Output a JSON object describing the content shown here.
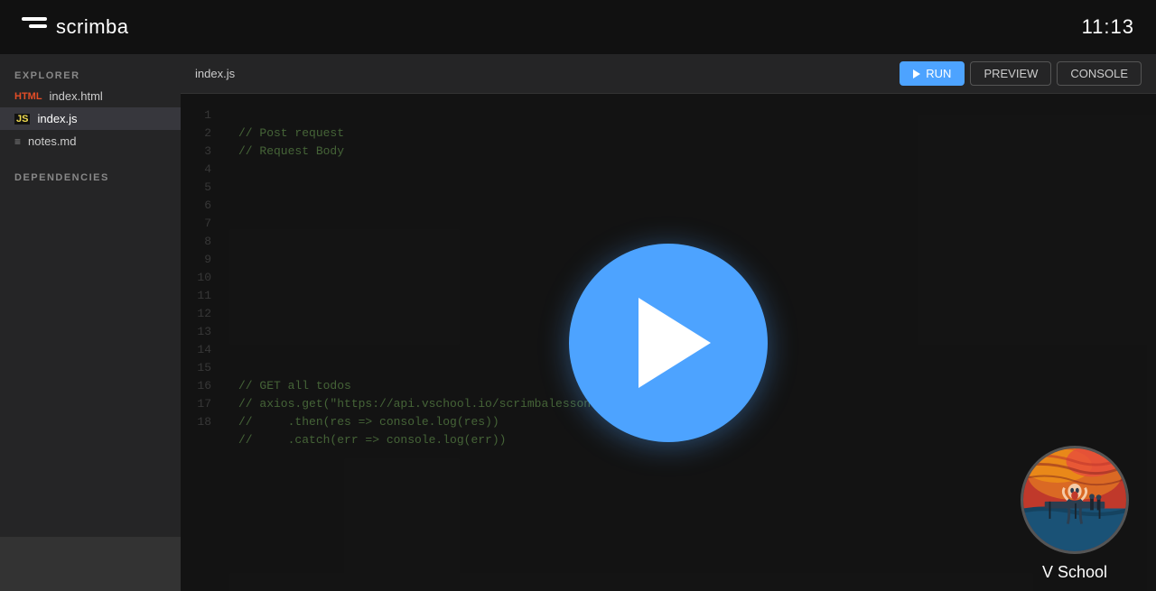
{
  "topbar": {
    "logo_text": "scrimba",
    "clock": "11:13"
  },
  "sidebar": {
    "section_title": "EXPLORER",
    "files": [
      {
        "name": "index.html",
        "icon": "html",
        "active": false
      },
      {
        "name": "index.js",
        "icon": "js",
        "active": true
      },
      {
        "name": "notes.md",
        "icon": "md",
        "active": false
      }
    ],
    "deps_title": "DEPENDENCIES"
  },
  "editor": {
    "active_file": "index.js",
    "buttons": {
      "run": "RUN",
      "preview": "PREVIEW",
      "console": "CONSOLE"
    },
    "lines": [
      {
        "num": 1,
        "code": "// Post request",
        "type": "comment"
      },
      {
        "num": 2,
        "code": "// Request Body",
        "type": "comment"
      },
      {
        "num": 3,
        "code": "",
        "type": "empty"
      },
      {
        "num": 4,
        "code": "",
        "type": "empty"
      },
      {
        "num": 5,
        "code": "",
        "type": "empty"
      },
      {
        "num": 6,
        "code": "",
        "type": "empty"
      },
      {
        "num": 7,
        "code": "",
        "type": "empty"
      },
      {
        "num": 8,
        "code": "",
        "type": "empty"
      },
      {
        "num": 9,
        "code": "",
        "type": "empty"
      },
      {
        "num": 10,
        "code": "",
        "type": "empty"
      },
      {
        "num": 11,
        "code": "",
        "type": "empty"
      },
      {
        "num": 12,
        "code": "",
        "type": "empty"
      },
      {
        "num": 13,
        "code": "",
        "type": "empty"
      },
      {
        "num": 14,
        "code": "",
        "type": "empty"
      },
      {
        "num": 15,
        "code": "// GET all todos",
        "type": "comment"
      },
      {
        "num": 16,
        "code": "// axios.get(\"https://api.vschool.io/scrimbalessons/todo\")",
        "type": "comment"
      },
      {
        "num": 17,
        "code": "//     .then(res => console.log(res))",
        "type": "comment"
      },
      {
        "num": 18,
        "code": "//     .catch(err => console.log(err))",
        "type": "comment"
      }
    ]
  },
  "vschool": {
    "name": "V School"
  }
}
